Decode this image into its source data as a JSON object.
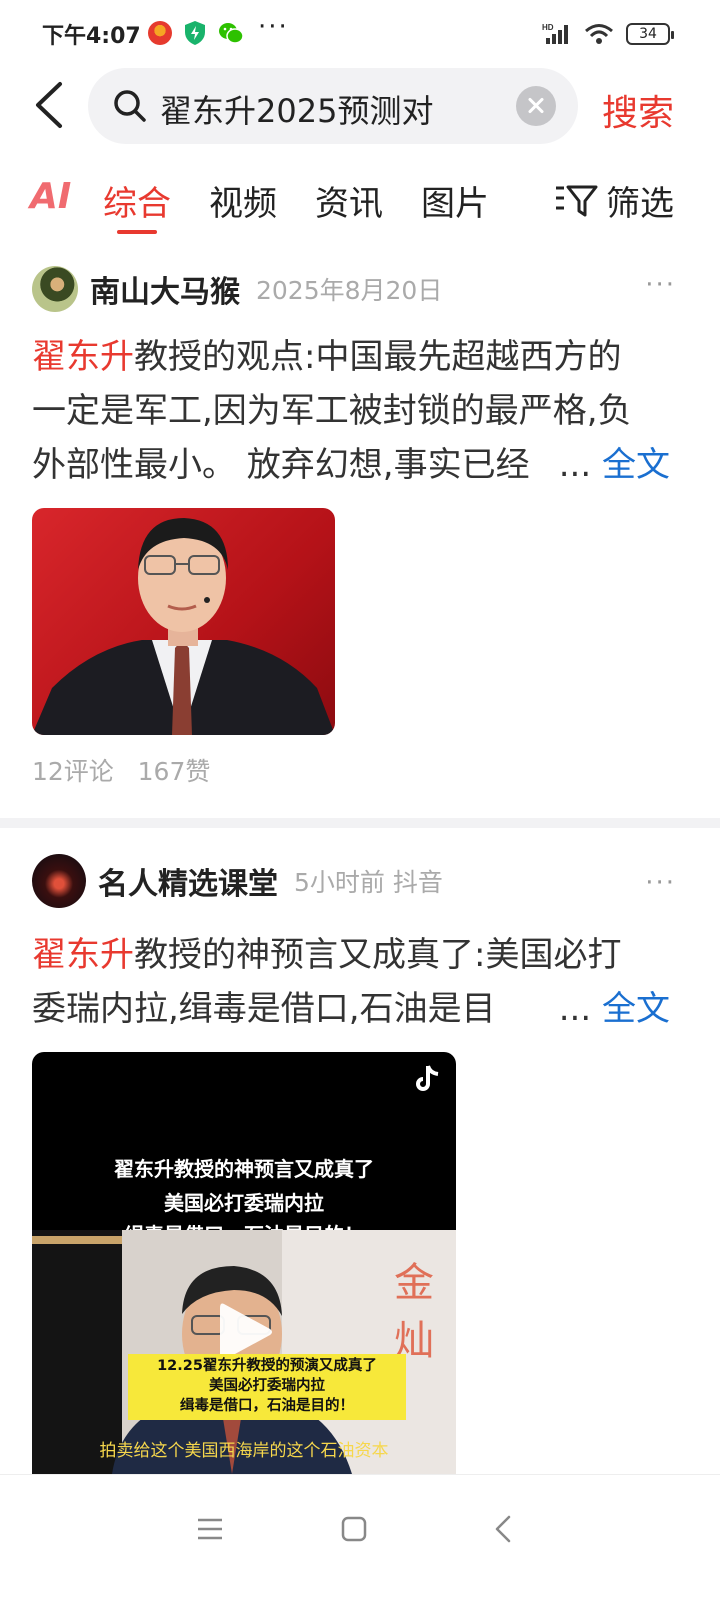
{
  "status_bar": {
    "time": "下午4:07",
    "more": "···",
    "battery": "34"
  },
  "search": {
    "query": "翟东升2025预测对",
    "submit_label": "搜索"
  },
  "tabs": {
    "ai_label": "AI",
    "items": [
      "综合",
      "视频",
      "资讯",
      "图片"
    ],
    "active": "综合",
    "filter_label": "筛选"
  },
  "posts": [
    {
      "author": "南山大马猴",
      "meta": "2025年8月20日",
      "highlight": "翟东升",
      "text_line1": "教授的观点:中国最先超越西方的",
      "text_line2": "一定是军工,因为军工被封锁的最严格,负",
      "text_line3": "外部性最小。 放弃幻想,事实已经",
      "ellipsis": "...",
      "fulltext_label": "全文",
      "comments": "12评论",
      "likes": "167赞"
    },
    {
      "author": "名人精选课堂",
      "meta": "5小时前 抖音",
      "highlight": "翟东升",
      "text_line1": "教授的神预言又成真了:美国必打",
      "text_line2": "委瑞内拉,缉毒是借口,石油是目",
      "ellipsis": "...",
      "fulltext_label": "全文",
      "video": {
        "caption_line1": "翟东升教授的神预言又成真了",
        "caption_line2": "美国必打委瑞内拉",
        "caption_line3": "缉毒是借口，石油是目的！",
        "box_line1": "12.25翟东升教授的预演又成真了",
        "box_line2": "美国必打委瑞内拉",
        "box_line3": "缉毒是借口，石油是目的！",
        "subtitle": "拍卖给这个美国西海岸的这个石油资本",
        "bg_sign": "金灿"
      }
    }
  ],
  "colors": {
    "accent": "#e8392f",
    "link": "#1a6fd0",
    "muted": "#aaaaaa"
  }
}
